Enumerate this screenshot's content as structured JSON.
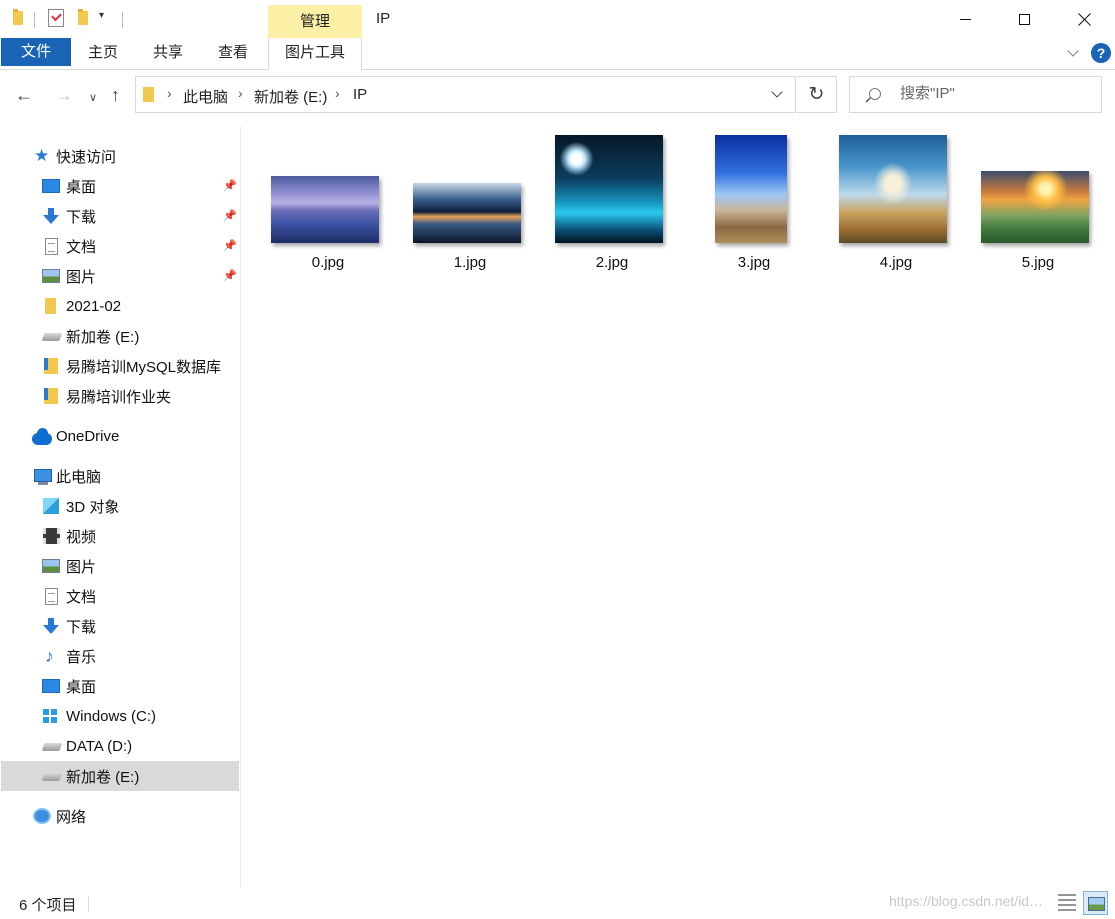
{
  "window": {
    "title": "IP",
    "context_tab": "管理"
  },
  "ribbon": {
    "file_tab": "文件",
    "tabs": [
      "主页",
      "共享",
      "查看",
      "图片工具"
    ]
  },
  "address": {
    "crumbs": [
      "此电脑",
      "新加卷 (E:)",
      "IP"
    ]
  },
  "search": {
    "placeholder": "搜索\"IP\""
  },
  "sidebar": {
    "quick_access": "快速访问",
    "quick_items": [
      "桌面",
      "下载",
      "文档",
      "图片",
      "2021-02",
      "新加卷 (E:)",
      "易腾培训MySQL数据库",
      "易腾培训作业夹"
    ],
    "onedrive": "OneDrive",
    "this_pc": "此电脑",
    "pc_items": [
      "3D 对象",
      "视频",
      "图片",
      "文档",
      "下载",
      "音乐",
      "桌面",
      "Windows (C:)",
      "DATA (D:)",
      "新加卷 (E:)"
    ],
    "selected": "新加卷 (E:)",
    "network": "网络"
  },
  "files": [
    "0.jpg",
    "1.jpg",
    "2.jpg",
    "3.jpg",
    "4.jpg",
    "5.jpg"
  ],
  "status": {
    "count": "6 个项目",
    "watermark": "https://blog.csdn.net/id…"
  },
  "colors": {
    "accent": "#1a64b5",
    "manage_tab": "#fbf0a6",
    "selected_row": "#d9d9d9"
  }
}
